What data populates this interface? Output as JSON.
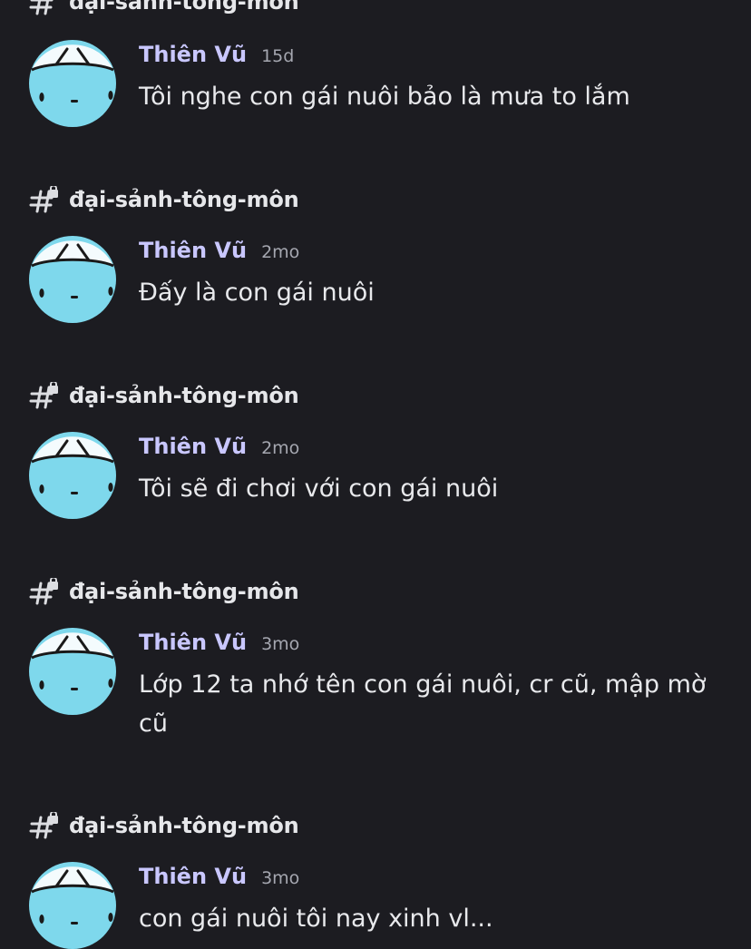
{
  "results": [
    {
      "channel": "đại-sảnh-tông-môn",
      "author": "Thiên Vũ",
      "time": "15d",
      "text": "Tôi nghe con gái nuôi bảo là mưa to lắm"
    },
    {
      "channel": "đại-sảnh-tông-môn",
      "author": "Thiên Vũ",
      "time": "2mo",
      "text": "Đấy là con gái nuôi"
    },
    {
      "channel": "đại-sảnh-tông-môn",
      "author": "Thiên Vũ",
      "time": "2mo",
      "text": "Tôi sẽ đi chơi với con gái nuôi"
    },
    {
      "channel": "đại-sảnh-tông-môn",
      "author": "Thiên Vũ",
      "time": "3mo",
      "text": "Lớp 12 ta nhớ tên con gái nuôi, cr cũ, mập mờ cũ"
    },
    {
      "channel": "đại-sảnh-tông-môn",
      "author": "Thiên Vũ",
      "time": "3mo",
      "text": "con gái nuôi tôi nay xinh vl..."
    }
  ],
  "icons": {
    "channel": "locked-hashtag-icon",
    "avatar": "cyan-face-avatar"
  },
  "colors": {
    "background": "#1c1c21",
    "author": "#c9c7ff",
    "avatar": "#7ed8ec"
  }
}
